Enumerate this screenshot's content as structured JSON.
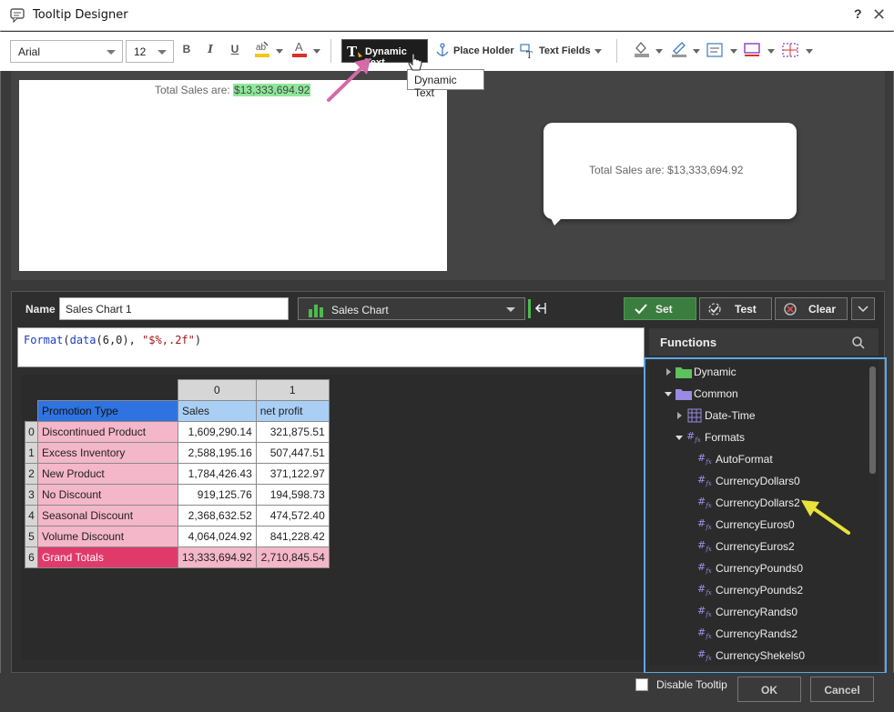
{
  "window": {
    "title": "Tooltip Designer",
    "help": "?",
    "close": "✕"
  },
  "toolbar": {
    "font_family": "Arial",
    "font_size": "12",
    "bold": "B",
    "italic": "I",
    "underline": "U",
    "dynamic_text": "Dynamic Text",
    "place_holder": "Place Holder",
    "text_fields": "Text Fields",
    "tooltip_hint": "Dynamic Text"
  },
  "preview": {
    "label": "Total Sales are: ",
    "value": "$13,333,694.92",
    "bubble_text": "Total Sales are: $13,333,694.92"
  },
  "editor": {
    "name_label": "Name",
    "name_value": "Sales Chart 1",
    "chart_select": "Sales Chart",
    "set": "Set",
    "test": "Test",
    "clear": "Clear",
    "formula": {
      "fn1": "Format",
      "p1": "(",
      "fn2": "data",
      "args": "(6,0), ",
      "fmt": "\"$%,.2f\"",
      "p2": ")"
    }
  },
  "table": {
    "col_headers": [
      "0",
      "1"
    ],
    "header_row": {
      "label": "Promotion Type",
      "c0": "Sales",
      "c1": "net profit"
    },
    "rows": [
      {
        "idx": "0",
        "label": "Discontinued Product",
        "c0": "1,609,290.14",
        "c1": "321,875.51"
      },
      {
        "idx": "1",
        "label": "Excess Inventory",
        "c0": "2,588,195.16",
        "c1": "507,447.51"
      },
      {
        "idx": "2",
        "label": "New Product",
        "c0": "1,784,426.43",
        "c1": "371,122.97"
      },
      {
        "idx": "3",
        "label": "No Discount",
        "c0": "919,125.76",
        "c1": "194,598.73"
      },
      {
        "idx": "4",
        "label": "Seasonal Discount",
        "c0": "2,368,632.52",
        "c1": "474,572.40"
      },
      {
        "idx": "5",
        "label": "Volume Discount",
        "c0": "4,064,024.92",
        "c1": "841,228.42"
      },
      {
        "idx": "6",
        "label": "Grand Totals",
        "c0": "13,333,694.92",
        "c1": "2,710,845.54"
      }
    ]
  },
  "functions": {
    "title": "Functions",
    "tree": {
      "dynamic": "Dynamic",
      "common": "Common",
      "date_time": "Date-Time",
      "formats": "Formats",
      "items": [
        "AutoFormat",
        "CurrencyDollars0",
        "CurrencyDollars2",
        "CurrencyEuros0",
        "CurrencyEuros2",
        "CurrencyPounds0",
        "CurrencyPounds2",
        "CurrencyRands0",
        "CurrencyRands2",
        "CurrencyShekels0"
      ]
    }
  },
  "footer": {
    "disable_tooltip": "Disable Tooltip",
    "ok": "OK",
    "cancel": "Cancel"
  },
  "colors": {
    "accent_blue": "#5aa7e6",
    "set_green": "#3b7d3f",
    "header_blue": "#2f73e0",
    "pink": "#f4b6c9",
    "total_pink": "#e03a6a",
    "highlight_green": "#8ee89a"
  }
}
